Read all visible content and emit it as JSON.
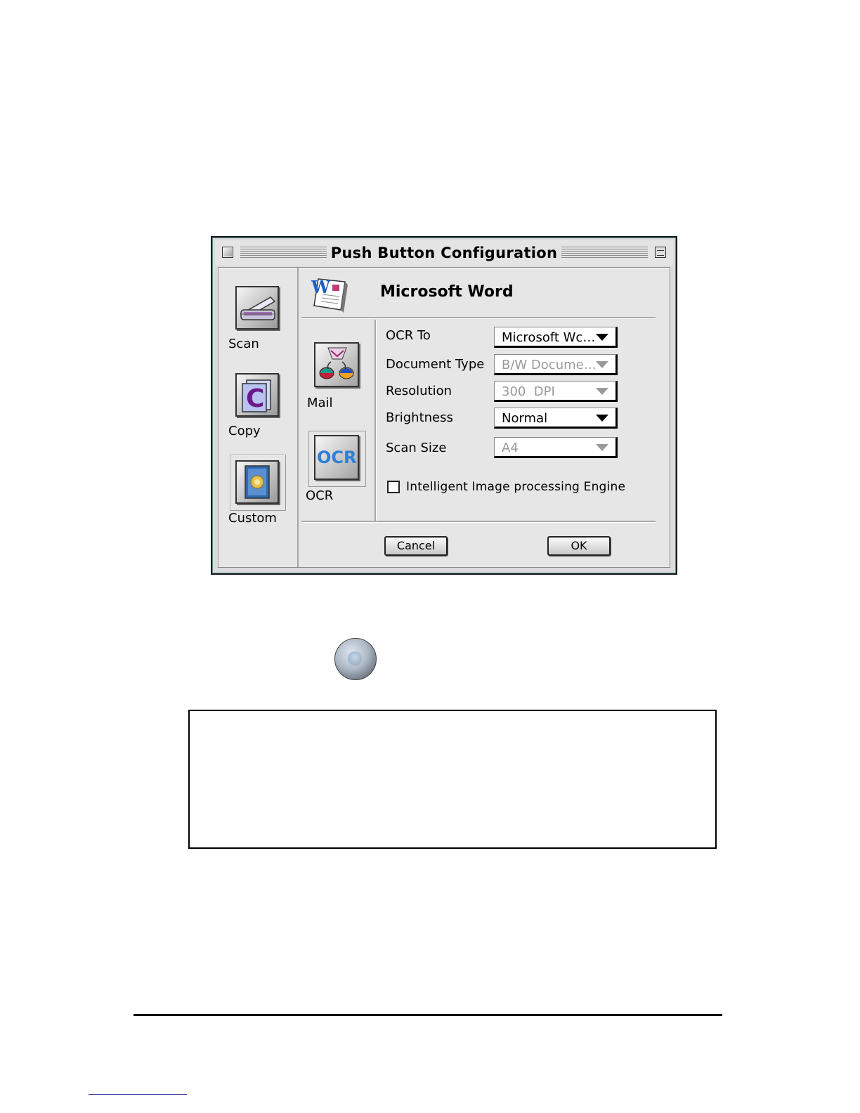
{
  "window": {
    "title": "Push Button Configuration"
  },
  "left_panel": {
    "items": [
      {
        "label": "Scan",
        "icon": "scanner-icon"
      },
      {
        "label": "Copy",
        "icon": "copy-icon"
      },
      {
        "label": "Custom",
        "icon": "custom-icon"
      }
    ],
    "selected": "Custom"
  },
  "header": {
    "app_name": "Microsoft Word",
    "icon": "microsoft-word-icon"
  },
  "middle_panel": {
    "items": [
      {
        "label": "Mail",
        "icon": "mail-icon"
      },
      {
        "label": "OCR",
        "icon": "ocr-icon",
        "icon_text": "OCR"
      }
    ],
    "selected": "OCR"
  },
  "settings": {
    "ocr_to": {
      "label": "OCR To",
      "value": "Microsoft Wc…",
      "enabled": true
    },
    "document_type": {
      "label": "Document Type",
      "value": "B/W Docume…",
      "enabled": false
    },
    "resolution": {
      "label": "Resolution",
      "value": "300  DPI",
      "enabled": false
    },
    "brightness": {
      "label": "Brightness",
      "value": "Normal",
      "enabled": true
    },
    "scan_size": {
      "label": "Scan Size",
      "value": "A4",
      "enabled": false
    },
    "intelligent_engine": {
      "label": "Intelligent Image processing Engine",
      "checked": false
    }
  },
  "buttons": {
    "cancel": "Cancel",
    "ok": "OK"
  },
  "colors": {
    "ocr_blue": "#2f7fd6",
    "word_blue": "#1f5fbf",
    "copy_purple": "#6a1a8a",
    "dialog_gray": "#dcdcdc"
  }
}
